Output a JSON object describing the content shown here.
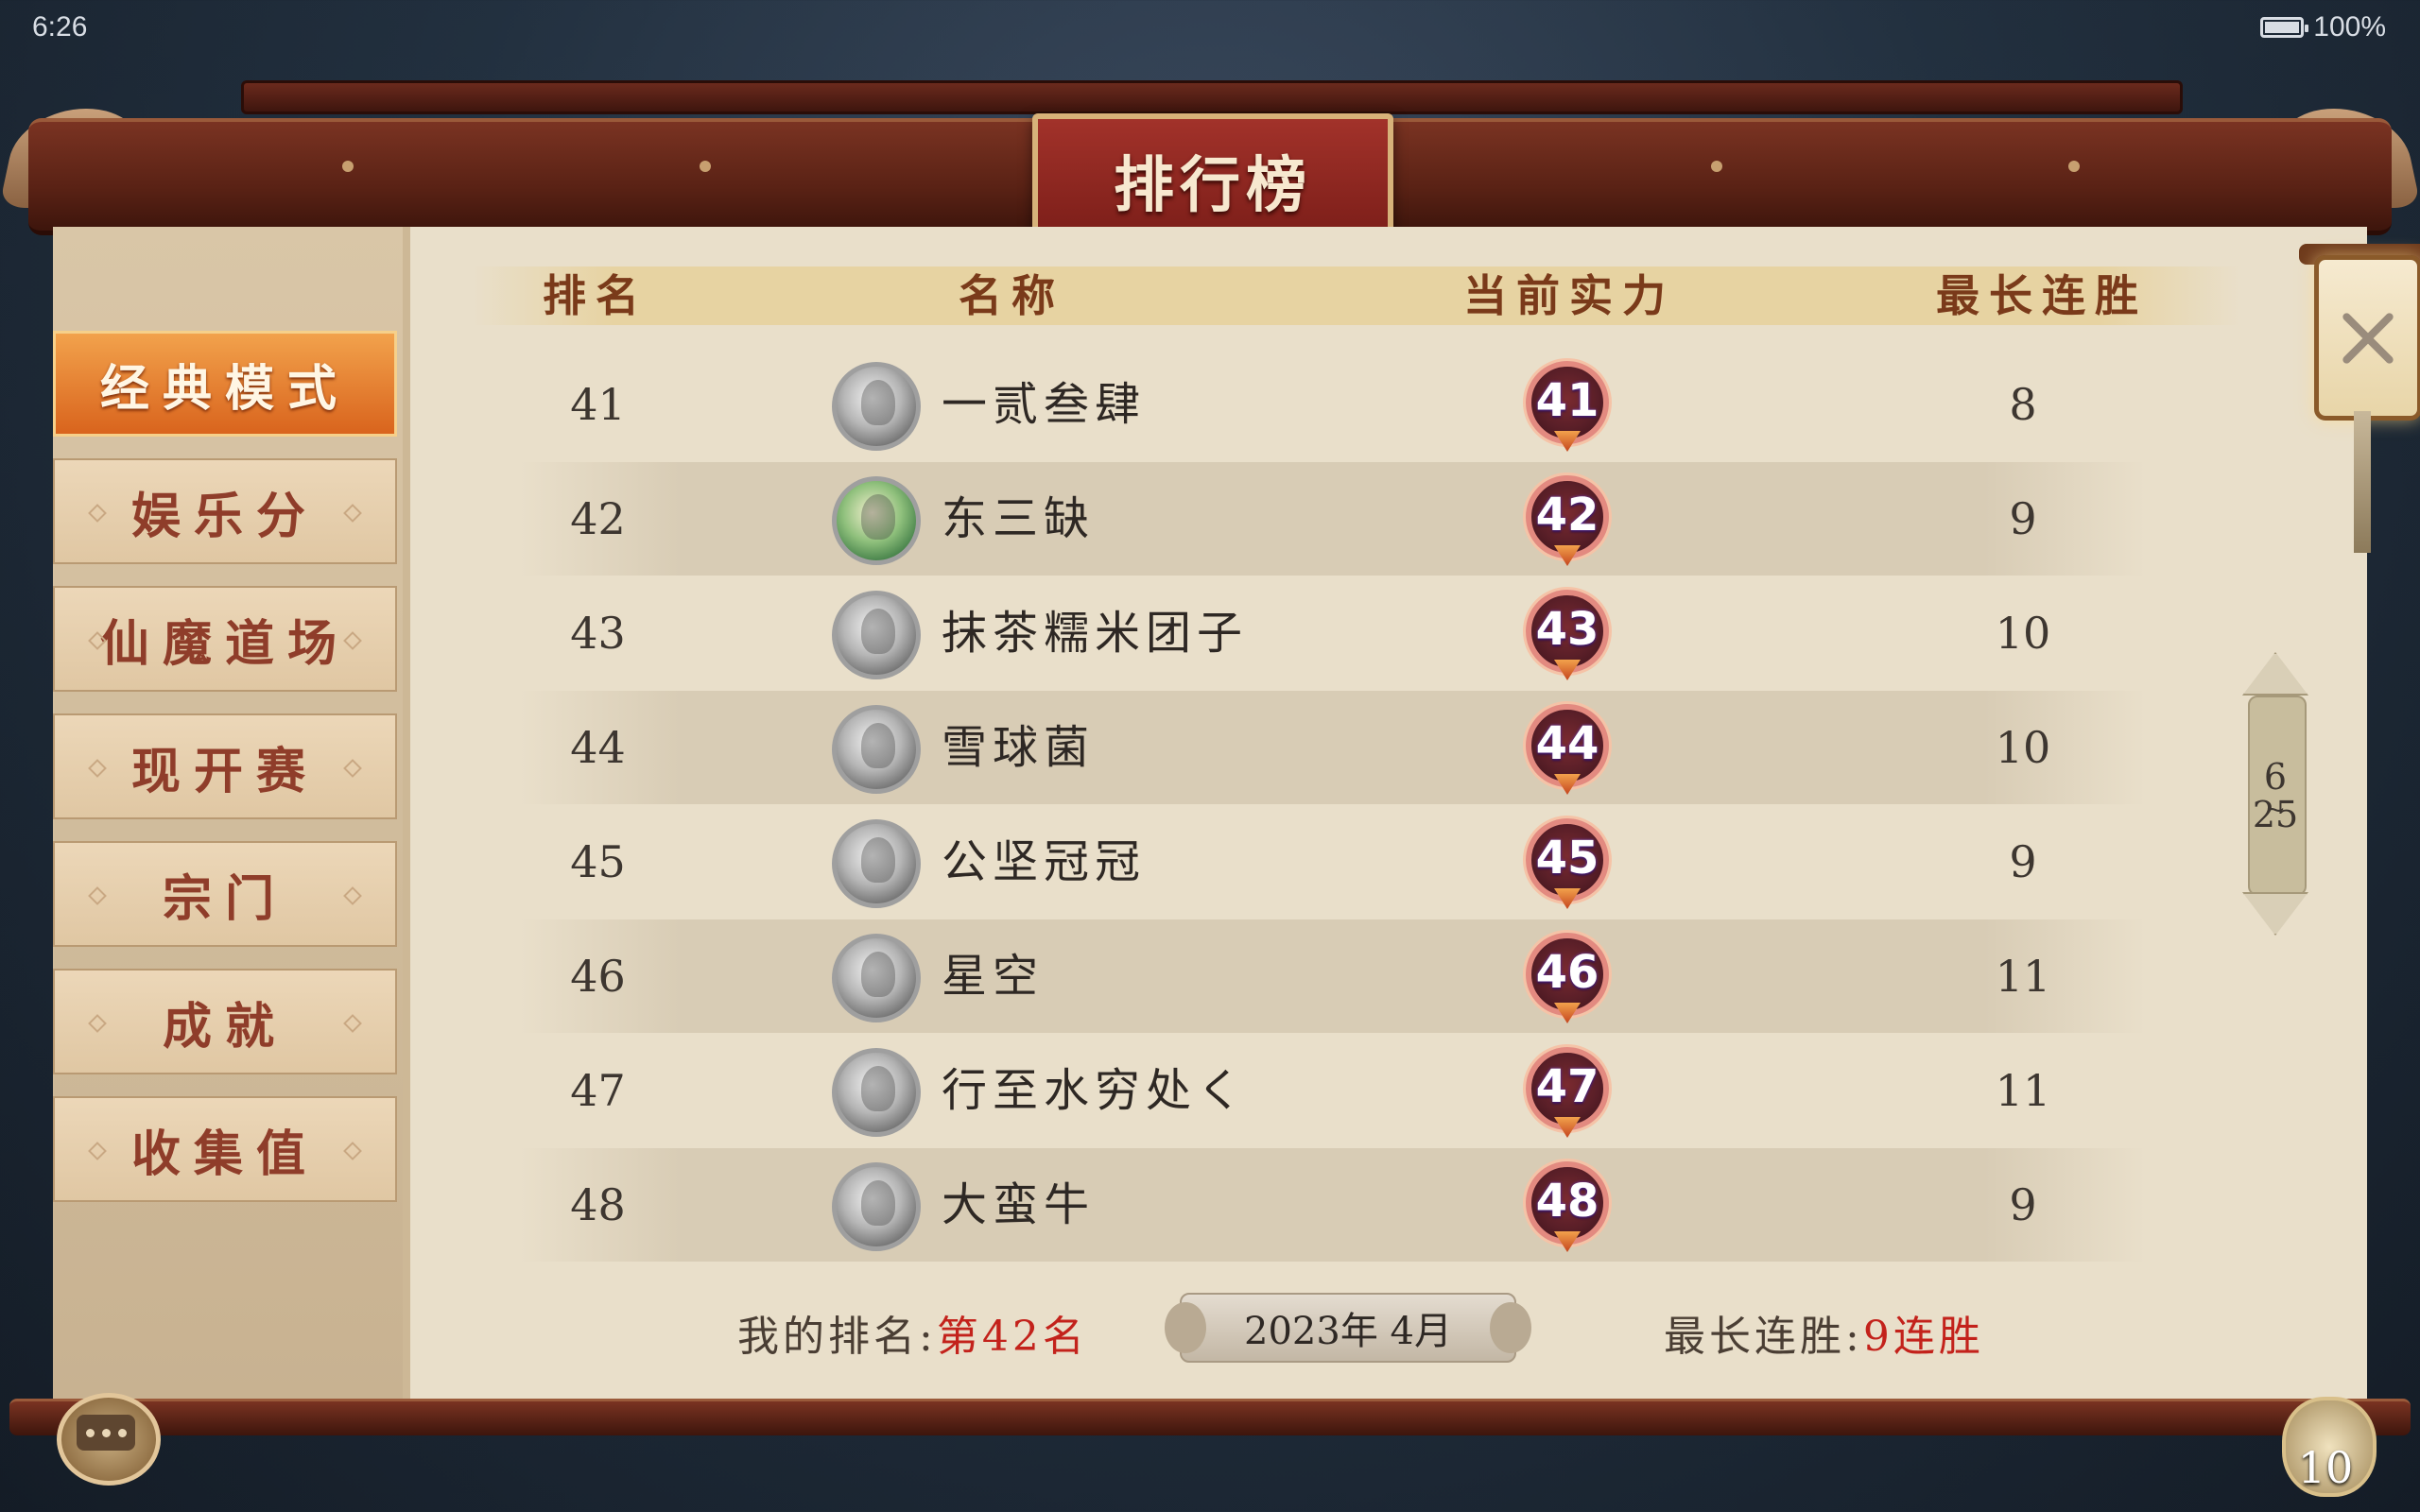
{
  "status_bar": {
    "time": "6:26",
    "battery": "100%"
  },
  "title": "排行榜",
  "sidebar": {
    "items": [
      {
        "label": "经典模式",
        "active": true
      },
      {
        "label": "娱乐分",
        "active": false
      },
      {
        "label": "仙魔道场",
        "active": false
      },
      {
        "label": "现开赛",
        "active": false
      },
      {
        "label": "宗门",
        "active": false
      },
      {
        "label": "成就",
        "active": false
      },
      {
        "label": "收集值",
        "active": false
      }
    ]
  },
  "table": {
    "headers": [
      "排名",
      "名称",
      "当前实力",
      "最长连胜"
    ],
    "rows": [
      {
        "rank": "41",
        "name": "一贰叁肆",
        "level": "41",
        "streak": "8"
      },
      {
        "rank": "42",
        "name": "东三缺",
        "level": "42",
        "streak": "9"
      },
      {
        "rank": "43",
        "name": "抹茶糯米团子",
        "level": "43",
        "streak": "10"
      },
      {
        "rank": "44",
        "name": "雪球菌",
        "level": "44",
        "streak": "10"
      },
      {
        "rank": "45",
        "name": "公坚冠冠",
        "level": "45",
        "streak": "9"
      },
      {
        "rank": "46",
        "name": "星空",
        "level": "46",
        "streak": "11"
      },
      {
        "rank": "47",
        "name": "行至水穷处く",
        "level": "47",
        "streak": "11"
      },
      {
        "rank": "48",
        "name": "大蛮牛",
        "level": "48",
        "streak": "9"
      }
    ]
  },
  "footer": {
    "my_rank_label": "我的排名:",
    "my_rank_value": "第42名",
    "date": "2023年 4月",
    "streak_label": "最长连胜:",
    "streak_value": "9连胜"
  },
  "pager": {
    "current": "6",
    "total": "25"
  },
  "bottom": {
    "coin_count": "10"
  },
  "colors": {
    "accent_red": "#c3221b",
    "active_tab": "#e8802f",
    "beam": "#5a2215"
  }
}
